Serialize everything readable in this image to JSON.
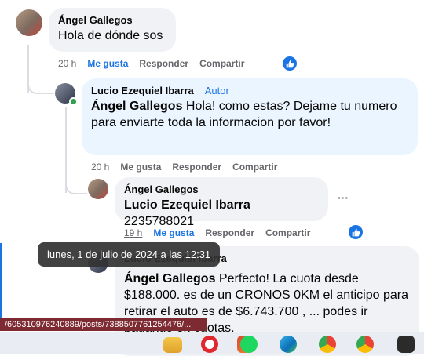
{
  "comments": [
    {
      "author": "Ángel Gallegos",
      "text": "Hola de dónde sos",
      "time": "20 h",
      "like": "Me gusta",
      "reply": "Responder",
      "share": "Compartir"
    },
    {
      "author": "Lucio Ezequiel Ibarra",
      "badge": "Autor",
      "mention": "Ángel Gallegos",
      "text": " Hola! como estas? Dejame tu numero para enviarte toda la informacion por favor!",
      "time": "20 h",
      "like": "Me gusta",
      "reply": "Responder",
      "share": "Compartir"
    },
    {
      "author": "Ángel Gallegos",
      "mention": "Lucio Ezequiel Ibarra",
      "text": " 2235788021",
      "more": "···",
      "time": "19 h",
      "like": "Me gusta",
      "reply": "Responder",
      "share": "Compartir"
    },
    {
      "author": "Lucio Ezequiel Ibarra",
      "mention": "Ángel Gallegos",
      "text": " Perfecto! La cuota desde $188.000. es de un CRONOS 0KM el anticipo para retirar el auto es de $6.743.700 , ... podes ir pagando en cuotas."
    }
  ],
  "tooltip": "lunes, 1 de julio de 2024 a las 12:31",
  "status_url": "/605310976240889/posts/7388507761254476/...",
  "colors": {
    "accent": "#1b74e4",
    "bubble": "#f0f2f5",
    "bubble_highlight": "#ebf5ff"
  },
  "taskbar_icons": [
    "file-explorer-icon",
    "opera-icon",
    "office-icon",
    "spotify-icon",
    "edge-icon",
    "chrome-icon",
    "chrome-profile-icon"
  ]
}
